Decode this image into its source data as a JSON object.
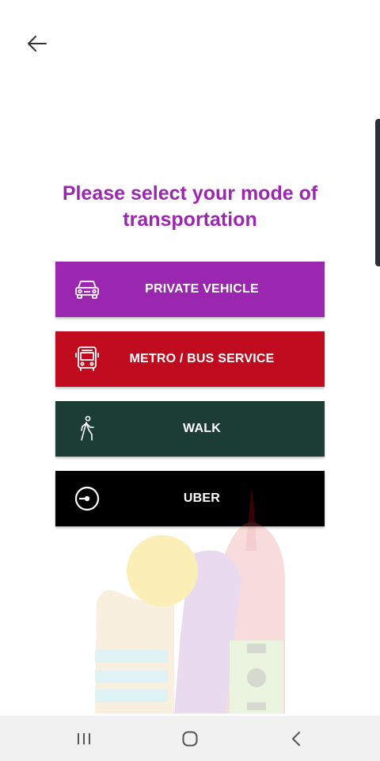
{
  "header": {
    "back_icon": "arrow-left-icon"
  },
  "title": "Please select your mode of transportation",
  "modes": [
    {
      "label": "PRIVATE VEHICLE",
      "icon": "car-icon",
      "color": "#9b27b0"
    },
    {
      "label": "METRO / BUS SERVICE",
      "icon": "bus-icon",
      "color": "#c00a1d"
    },
    {
      "label": "WALK",
      "icon": "walking-person-icon",
      "color": "#1b3d33"
    },
    {
      "label": "UBER",
      "icon": "uber-logo-icon",
      "color": "#000000"
    }
  ],
  "navbar": {
    "recents_icon": "recent-apps-icon",
    "home_icon": "home-icon",
    "back_icon": "nav-back-icon"
  }
}
